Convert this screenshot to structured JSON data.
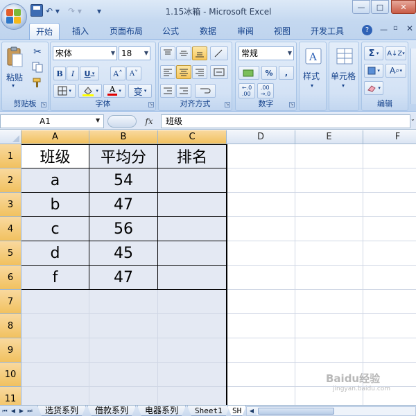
{
  "window": {
    "title": "1.15冰箱 - Microsoft Excel",
    "min": "—",
    "max": "□",
    "close": "✕"
  },
  "qat": {
    "undo": "↶ ▾",
    "redo": "↷ ▾",
    "customize": "▾"
  },
  "tabs": [
    {
      "label": "开始",
      "active": true
    },
    {
      "label": "插入"
    },
    {
      "label": "页面布局"
    },
    {
      "label": "公式"
    },
    {
      "label": "数据"
    },
    {
      "label": "审阅"
    },
    {
      "label": "视图"
    },
    {
      "label": "开发工具"
    }
  ],
  "tab_controls": {
    "help": "?",
    "minimize": "—",
    "restore": "▫",
    "close": "✕"
  },
  "ribbon": {
    "clipboard": {
      "label": "剪贴板",
      "paste": "粘贴"
    },
    "font": {
      "label": "字体",
      "family": "宋体",
      "size": "18",
      "bold": "B",
      "italic": "I",
      "underline": "U",
      "grow": "A˄",
      "shrink": "A˅",
      "color_letter": "A",
      "phonetic": "变",
      "fill_color": "#ffff00",
      "font_color": "#e00000"
    },
    "alignment": {
      "label": "对齐方式"
    },
    "number": {
      "label": "数字",
      "format": "常规",
      "percent": "%",
      "comma": ",",
      "inc_decimal": "←.0\n.00",
      "dec_decimal": ".00\n→.0"
    },
    "styles": {
      "label": "样式"
    },
    "cells": {
      "label": "单元格"
    },
    "editing": {
      "label": "编辑",
      "sum": "Σ",
      "sort": "A↓Z",
      "find": "A"
    }
  },
  "formula_bar": {
    "name_box": "A1",
    "fx": "fx",
    "content": "班级"
  },
  "columns": [
    "A",
    "B",
    "C",
    "D",
    "E",
    "F"
  ],
  "rows": [
    "1",
    "2",
    "3",
    "4",
    "5",
    "6",
    "7",
    "8",
    "9",
    "10",
    "11"
  ],
  "table": {
    "header": [
      "班级",
      "平均分",
      "排名"
    ],
    "data": [
      [
        "a",
        "54",
        ""
      ],
      [
        "b",
        "47",
        ""
      ],
      [
        "c",
        "56",
        ""
      ],
      [
        "d",
        "45",
        ""
      ],
      [
        "f",
        "47",
        ""
      ]
    ]
  },
  "sheets": [
    {
      "label": "选货系列"
    },
    {
      "label": "借款系列"
    },
    {
      "label": "电器系列"
    },
    {
      "label": "Sheet1"
    },
    {
      "label": "SH"
    }
  ],
  "watermark": {
    "main": "Baidu经验",
    "sub": "jingyan.baidu.com"
  }
}
